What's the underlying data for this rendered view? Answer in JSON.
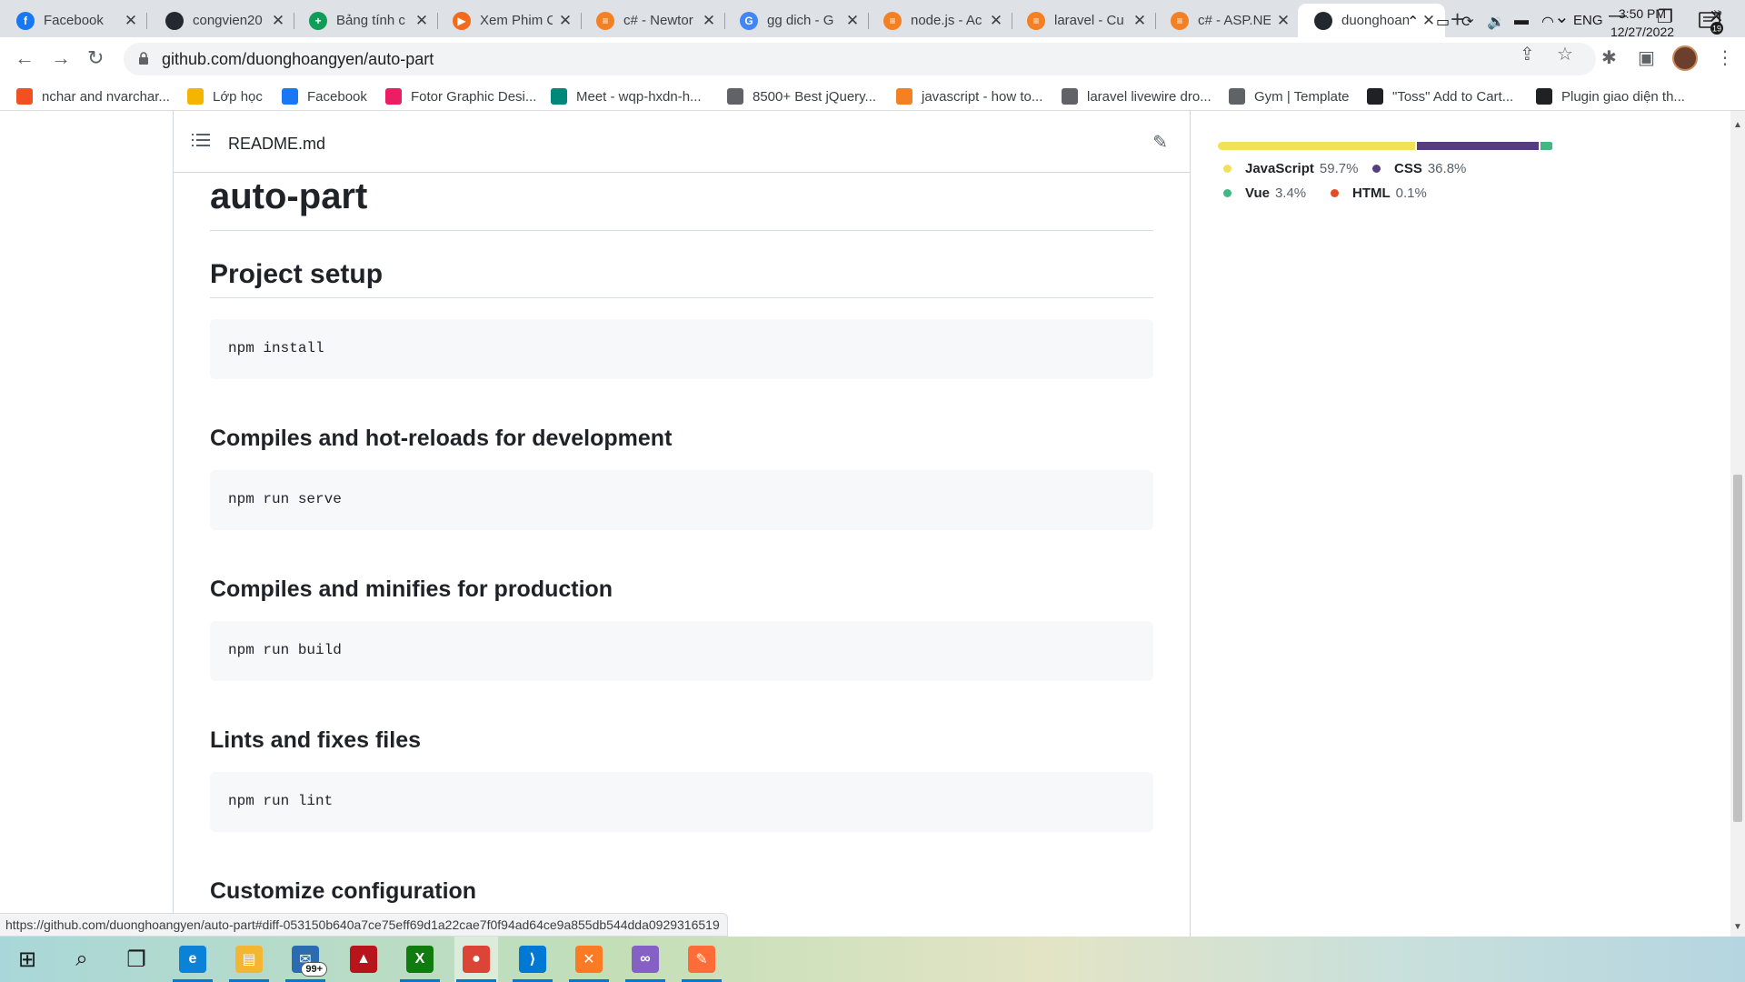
{
  "browser": {
    "tabs": [
      {
        "title": "Facebook",
        "icon": "facebook-icon",
        "color": "#1877f2",
        "glyph": "f"
      },
      {
        "title": "congvien20",
        "icon": "github-icon",
        "color": "#24292f",
        "glyph": ""
      },
      {
        "title": "Bảng tính c",
        "icon": "sheets-icon",
        "color": "#0f9d58",
        "glyph": "+"
      },
      {
        "title": "Xem Phim C",
        "icon": "play-icon",
        "color": "#f26b1d",
        "glyph": "▶"
      },
      {
        "title": "c# - Newtor",
        "icon": "stackoverflow-icon",
        "color": "#f48024",
        "glyph": "≡"
      },
      {
        "title": "gg dich - G",
        "icon": "google-icon",
        "color": "#4285f4",
        "glyph": "G"
      },
      {
        "title": "node.js - Ac",
        "icon": "stackoverflow-icon",
        "color": "#f48024",
        "glyph": "≡"
      },
      {
        "title": "laravel - Cu",
        "icon": "stackoverflow-icon",
        "color": "#f48024",
        "glyph": "≡"
      },
      {
        "title": "c# - ASP.NE",
        "icon": "stackoverflow-icon",
        "color": "#f48024",
        "glyph": "≡"
      },
      {
        "title": "duonghoan",
        "icon": "github-icon",
        "color": "#24292f",
        "glyph": "",
        "active": true
      }
    ],
    "new_tab": "+",
    "url": "github.com/duonghoangyen/auto-part",
    "bookmarks": [
      {
        "label": "nchar and nvarchar...",
        "icon": "microsoft-icon",
        "color": "#f25022"
      },
      {
        "label": "Lớp học",
        "icon": "classroom-icon",
        "color": "#f4b400"
      },
      {
        "label": "Facebook",
        "icon": "facebook-icon",
        "color": "#1877f2"
      },
      {
        "label": "Fotor Graphic Desi...",
        "icon": "fotor-icon",
        "color": "#e91e63"
      },
      {
        "label": "Meet - wqp-hxdn-h...",
        "icon": "meet-icon",
        "color": "#00897b"
      },
      {
        "label": "8500+ Best jQuery...",
        "icon": "globe-icon",
        "color": "#5f6368"
      },
      {
        "label": "javascript - how to...",
        "icon": "stackoverflow-icon",
        "color": "#f48024"
      },
      {
        "label": "laravel livewire dro...",
        "icon": "globe-icon",
        "color": "#5f6368"
      },
      {
        "label": "Gym | Template",
        "icon": "globe-icon",
        "color": "#5f6368"
      },
      {
        "label": "\"Toss\" Add to Cart...",
        "icon": "codepen-icon",
        "color": "#202124"
      },
      {
        "label": "Plugin giao diện th...",
        "icon": "moon-icon",
        "color": "#202124"
      }
    ],
    "status_link": "https://github.com/duonghoangyen/auto-part#diff-053150b640a7ce75eff69d1a22cae7f0f94ad64ce9a855db544dda0929316519"
  },
  "readme": {
    "filename": "README.md",
    "title": "auto-part",
    "sections": [
      {
        "heading": "Project setup",
        "code": "npm install"
      },
      {
        "heading": "Compiles and hot-reloads for development",
        "code": "npm run serve"
      },
      {
        "heading": "Compiles and minifies for production",
        "code": "npm run build"
      },
      {
        "heading": "Lints and fixes files",
        "code": "npm run lint"
      },
      {
        "heading": "Customize configuration",
        "code": ""
      }
    ]
  },
  "languages": [
    {
      "name": "JavaScript",
      "percent": "59.7%",
      "value": 59.7,
      "color": "#f1e05a"
    },
    {
      "name": "CSS",
      "percent": "36.8%",
      "value": 36.8,
      "color": "#563d7c"
    },
    {
      "name": "Vue",
      "percent": "3.4%",
      "value": 3.4,
      "color": "#41b883"
    },
    {
      "name": "HTML",
      "percent": "0.1%",
      "value": 0.1,
      "color": "#e34c26"
    }
  ],
  "taskbar": {
    "apps": [
      {
        "name": "start-button",
        "color": "#1b1b1b",
        "glyph": "⊞"
      },
      {
        "name": "search-button",
        "color": "#1b1b1b",
        "glyph": "⌕"
      },
      {
        "name": "task-view-button",
        "color": "#1b1b1b",
        "glyph": "❐"
      },
      {
        "name": "edge-app",
        "color": "#0c82d6",
        "glyph": "e"
      },
      {
        "name": "file-explorer-app",
        "color": "#f2b632",
        "glyph": "▤"
      },
      {
        "name": "mail-app",
        "color": "#2b6cb0",
        "glyph": "✉"
      },
      {
        "name": "laravel-app",
        "color": "#b8141c",
        "glyph": "▲"
      },
      {
        "name": "xbox-app",
        "color": "#107c10",
        "glyph": "X"
      },
      {
        "name": "chrome-app",
        "color": "#db4437",
        "glyph": "●"
      },
      {
        "name": "vscode-app",
        "color": "#0078d4",
        "glyph": "⟩"
      },
      {
        "name": "xampp-app",
        "color": "#fb7a24",
        "glyph": "✕"
      },
      {
        "name": "visual-studio-app",
        "color": "#8661c5",
        "glyph": "∞"
      },
      {
        "name": "postman-app",
        "color": "#ff6c37",
        "glyph": "✎"
      }
    ],
    "mail_badge": "99+",
    "lang": "ENG",
    "time": "3:50 PM",
    "date": "12/27/2022",
    "notif_count": "19"
  }
}
